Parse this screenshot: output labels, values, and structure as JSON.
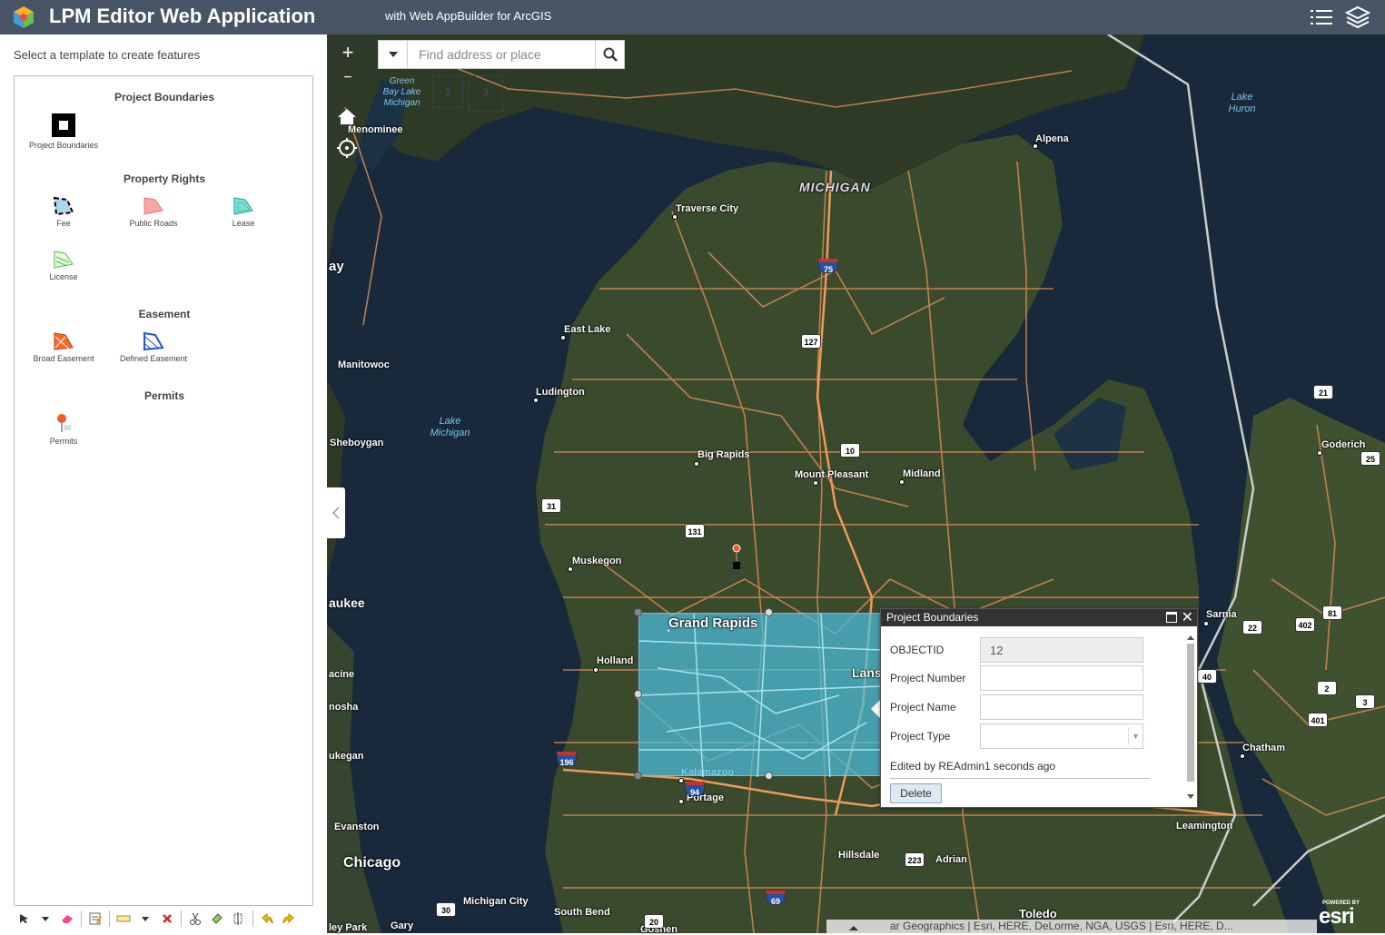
{
  "header": {
    "title": "LPM Editor Web Application",
    "subtitle": "with Web AppBuilder for ArcGIS",
    "icons": [
      "app-logo-icon",
      "list-icon",
      "layers-icon"
    ],
    "bg_color": "#485566"
  },
  "panel": {
    "hint": "Select a template to create features",
    "groups": [
      {
        "title": "Project Boundaries",
        "items": [
          {
            "label": "Project Boundaries",
            "icon": "square-symbol-icon"
          }
        ]
      },
      {
        "title": "Property Rights",
        "items": [
          {
            "label": "Fee",
            "icon": "fee-symbol-icon"
          },
          {
            "label": "Public Roads",
            "icon": "pink-polygon-icon"
          },
          {
            "label": "Lease",
            "icon": "teal-polygon-icon"
          },
          {
            "label": "License",
            "icon": "green-hatch-icon"
          }
        ]
      },
      {
        "title": "Easement",
        "items": [
          {
            "label": "Broad Easement",
            "icon": "orange-hatch-icon"
          },
          {
            "label": "Defined Easement",
            "icon": "blue-hatch-icon"
          }
        ]
      },
      {
        "title": "Permits",
        "items": [
          {
            "label": "Permits",
            "icon": "pushpin-icon"
          }
        ]
      }
    ],
    "toolbar": [
      "select-icon",
      "dropdown-icon",
      "eraser-icon",
      "attributes-icon",
      "rectangle-icon",
      "dropdown-icon",
      "delete-icon",
      "cut-icon",
      "reshape-icon",
      "merge-icon",
      "undo-icon",
      "redo-icon"
    ]
  },
  "map": {
    "search_placeholder": "Find address or place",
    "zoom_in": "+",
    "zoom_out": "−",
    "labels": {
      "michigan": "MICHIGAN",
      "lake_michigan": "Lake\nMichigan",
      "green_bay": "Green\nBay Lake\nMichigan",
      "lake_huron": "Lake\nHuron",
      "menominee": "Menominee",
      "alpena": "Alpena",
      "traverse_city": "Traverse City",
      "east_lake": "East Lake",
      "manitowoc": "Manitowoc",
      "ludington": "Ludington",
      "sheboygan": "Sheboygan",
      "big_rapids": "Big Rapids",
      "mount_pleasant": "Mount Pleasant",
      "midland": "Midland",
      "muskegon": "Muskegon",
      "grand_rapids": "Grand Rapids",
      "holland": "Holland",
      "lansing": "Lans",
      "kalamazoo": "Kalamazoo",
      "portage": "Portage",
      "evanston": "Evanston",
      "chicago": "Chicago",
      "hillsdale": "Hillsdale",
      "adrian": "Adrian",
      "toledo": "Toledo",
      "south_bend": "South Bend",
      "michigan_city": "Michigan City",
      "gary": "Gary",
      "goshen": "Goshen",
      "sarnia": "Sarnia",
      "chatham": "Chatham",
      "leamington": "Leamington",
      "goderich": "Goderich",
      "waukee": "aukee",
      "racine": "acine",
      "kenosha": "nosha",
      "waukegan": "ukegan",
      "bay": "ay",
      "highland_park": "ley Park"
    },
    "shields": {
      "i75": "75",
      "us127": "127",
      "us10": "10",
      "us131": "131",
      "us31": "31",
      "i196": "196",
      "i94": "94",
      "us223": "223",
      "i69": "69",
      "us20": "20",
      "on21": "21",
      "on25": "25",
      "on22": "22",
      "on402": "402",
      "on81": "81",
      "on40": "40",
      "on2": "2",
      "on3": "3",
      "on401": "401",
      "on30": "30"
    },
    "bookmarks": [
      "2",
      "3"
    ],
    "attribution": "ar Geographics | Esri, HERE, DeLorme, NGA, USGS | Esri, HERE, D...",
    "esri_powered": "POWERED BY",
    "esri": "esri"
  },
  "popup": {
    "title": "Project Boundaries",
    "fields": [
      {
        "label": "OBJECTID",
        "value": "12"
      },
      {
        "label": "Project Number",
        "value": ""
      },
      {
        "label": "Project Name",
        "value": ""
      },
      {
        "label": "Project Type",
        "value": ""
      }
    ],
    "status": "Edited by REAdmin1 seconds ago",
    "delete_label": "Delete"
  }
}
